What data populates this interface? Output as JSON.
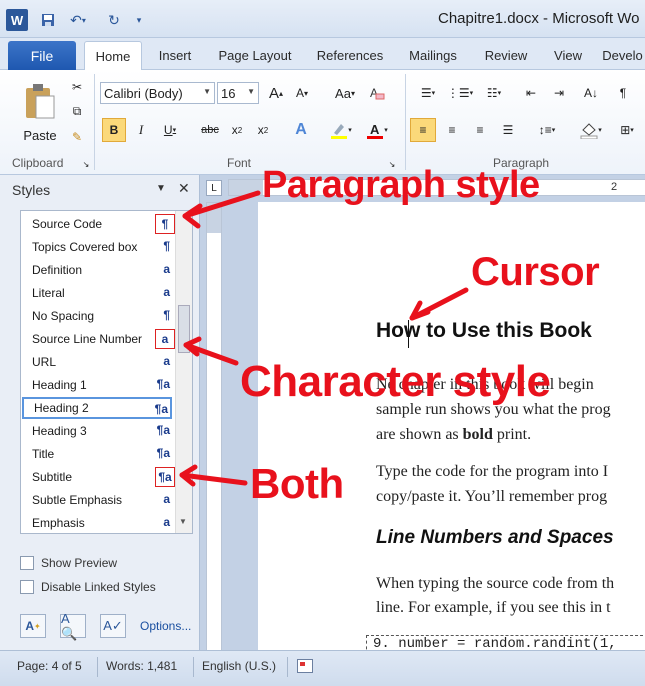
{
  "titlebar": {
    "doc_title": "Chapitre1.docx - Microsoft Wo",
    "qat": [
      "word-icon",
      "save-icon",
      "undo-icon",
      "redo-icon",
      "customize-icon"
    ]
  },
  "tabs": [
    "File",
    "Home",
    "Insert",
    "Page Layout",
    "References",
    "Mailings",
    "Review",
    "View",
    "Develo"
  ],
  "ribbon": {
    "clipboard_label": "Clipboard",
    "paste_label": "Paste",
    "font_label": "Font",
    "paragraph_label": "Paragraph",
    "font_name": "Calibri (Body)",
    "font_size": "16",
    "aa_label": "Aa"
  },
  "styles_pane": {
    "title": "Styles",
    "items": [
      {
        "label": "Source Code",
        "indicator": "¶"
      },
      {
        "label": "Topics Covered box",
        "indicator": "¶"
      },
      {
        "label": "Definition",
        "indicator": "a"
      },
      {
        "label": "Literal",
        "indicator": "a"
      },
      {
        "label": "No Spacing",
        "indicator": "¶"
      },
      {
        "label": "Source Line Number",
        "indicator": "a"
      },
      {
        "label": "URL",
        "indicator": "a"
      },
      {
        "label": "Heading 1",
        "indicator": "¶a"
      },
      {
        "label": "Heading 2",
        "indicator": "¶a"
      },
      {
        "label": "Heading 3",
        "indicator": "¶a"
      },
      {
        "label": "Title",
        "indicator": "¶a"
      },
      {
        "label": "Subtitle",
        "indicator": "¶a"
      },
      {
        "label": "Subtle Emphasis",
        "indicator": "a"
      },
      {
        "label": "Emphasis",
        "indicator": "a"
      }
    ],
    "show_preview": "Show Preview",
    "disable_linked": "Disable Linked Styles",
    "options": "Options..."
  },
  "document": {
    "heading": "How to Use this Book",
    "para1_l1": "Ne     chapter in this book will begin",
    "para1_l2": "sample run shows you what the prog",
    "para1_l3a": "are shown as ",
    "para1_l3b": "bold",
    "para1_l3c": " print.",
    "para2_l1": "Type the code for the program into I",
    "para2_l2": "copy/paste it. You’ll remember prog",
    "heading2": "Line Numbers and Spaces",
    "para3_l1": "When typing the source code from th",
    "para3_l2": "line. For example, if you see this in t",
    "code": "9. number = random.randint(1,",
    "ruler_mark": "2"
  },
  "statusbar": {
    "page": "Page: 4 of 5",
    "words": "Words: 1,481",
    "language": "English (U.S.)"
  },
  "annotations": {
    "paragraph_style": "Paragraph style",
    "cursor": "Cursor",
    "character_style": "Character style",
    "both": "Both"
  },
  "colors": {
    "annotation": "#e8111c",
    "accent": "#2b579a"
  }
}
